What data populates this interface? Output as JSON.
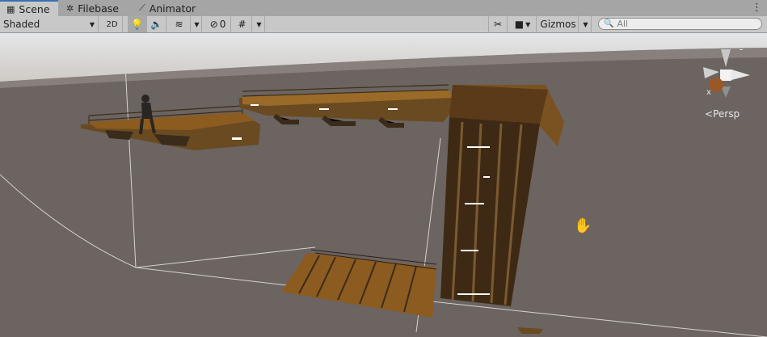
{
  "tabs": [
    {
      "label": "Scene",
      "icon": "grid-icon",
      "active": true
    },
    {
      "label": "Filebase",
      "icon": "filebase-icon",
      "active": false
    },
    {
      "label": "Animator",
      "icon": "animator-icon",
      "active": false
    }
  ],
  "toolbar": {
    "shading_mode": "Shaded",
    "mode_2d_label": "2D",
    "hidden_count": "0",
    "gizmos_label": "Gizmos",
    "search_placeholder": "All"
  },
  "scene_gizmo": {
    "projection_label": "Persp",
    "axis_x": "x",
    "axis_z": "z"
  },
  "colors": {
    "sky": "#dcdad8",
    "ground": "#6b6460",
    "wood": "#8a5a1e",
    "wood_dark": "#3a2410",
    "accent": "#3a72b0"
  }
}
